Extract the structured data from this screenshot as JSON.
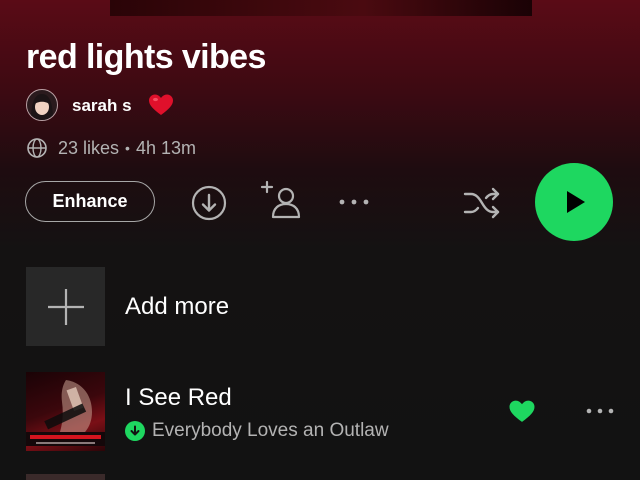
{
  "playlist": {
    "title": "red lights vibes",
    "owner": "sarah s",
    "likes": "23 likes",
    "separator": "•",
    "duration": "4h 13m"
  },
  "actions": {
    "enhance_label": "Enhance",
    "download_icon": "download-icon",
    "add_user_icon": "add-user-icon",
    "more_icon": "more-icon",
    "shuffle_icon": "shuffle-icon",
    "play_icon": "play-icon"
  },
  "list": {
    "add_more_label": "Add more",
    "tracks": [
      {
        "title": "I See Red",
        "album": "Everybody Loves an Outlaw",
        "liked": true,
        "downloaded": true
      }
    ]
  },
  "colors": {
    "accent": "#1ed760",
    "header_top": "#5a0b16",
    "background": "#121212",
    "muted_text": "#b3b3b3"
  }
}
